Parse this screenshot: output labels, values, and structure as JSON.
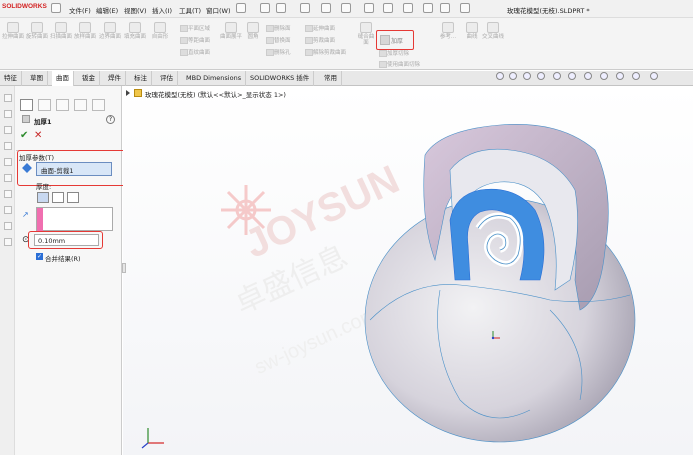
{
  "app": {
    "logo": "SOLIDWORKS",
    "doc_title": "玫瑰花模型(无枝).SLDPRT *"
  },
  "menu": [
    "文件(F)",
    "编辑(E)",
    "视图(V)",
    "插入(I)",
    "工具(T)",
    "窗口(W)"
  ],
  "ribbon": {
    "big": [
      "拉伸曲面",
      "旋转曲面",
      "扫描曲面",
      "放样曲面",
      "边界曲面",
      "填充曲面",
      "自由形"
    ],
    "small_a": [
      "平面区域",
      "等距曲面",
      "直纹曲面"
    ],
    "mid": [
      "曲面展平",
      "圆角"
    ],
    "small_b": [
      "删除面",
      "替换面",
      "删除孔"
    ],
    "small_c": [
      "延伸曲面",
      "剪裁曲面",
      "解除剪裁曲面"
    ],
    "small_d": [
      "缝合曲面"
    ],
    "thicken": "加厚",
    "small_e": [
      "加厚切除",
      "使用曲面切除"
    ],
    "ref": [
      "参考...",
      "曲线",
      "交叉曲线"
    ]
  },
  "tabs": [
    "特征",
    "草图",
    "曲面",
    "钣金",
    "焊件",
    "标注",
    "评估",
    "MBD Dimensions",
    "SOLIDWORKS 插件",
    "常用"
  ],
  "active_tab": "曲面",
  "tree": {
    "item": "玫瑰花模型(无枝) (默认<<默认>_显示状态 1>)"
  },
  "property": {
    "title": "加厚1",
    "section": "加厚参数(T)",
    "surface": "曲面-剪裁1",
    "thickness_label": "厚度:",
    "thickness_value": "0.10mm",
    "merge_label": "合并结果(R)"
  },
  "watermark": {
    "line1": "JOYSUN",
    "line2": "卓盛信息",
    "line3": "sw-joysun.com"
  },
  "colors": {
    "highlight": "#e53935",
    "accent": "#2b7cd3"
  }
}
